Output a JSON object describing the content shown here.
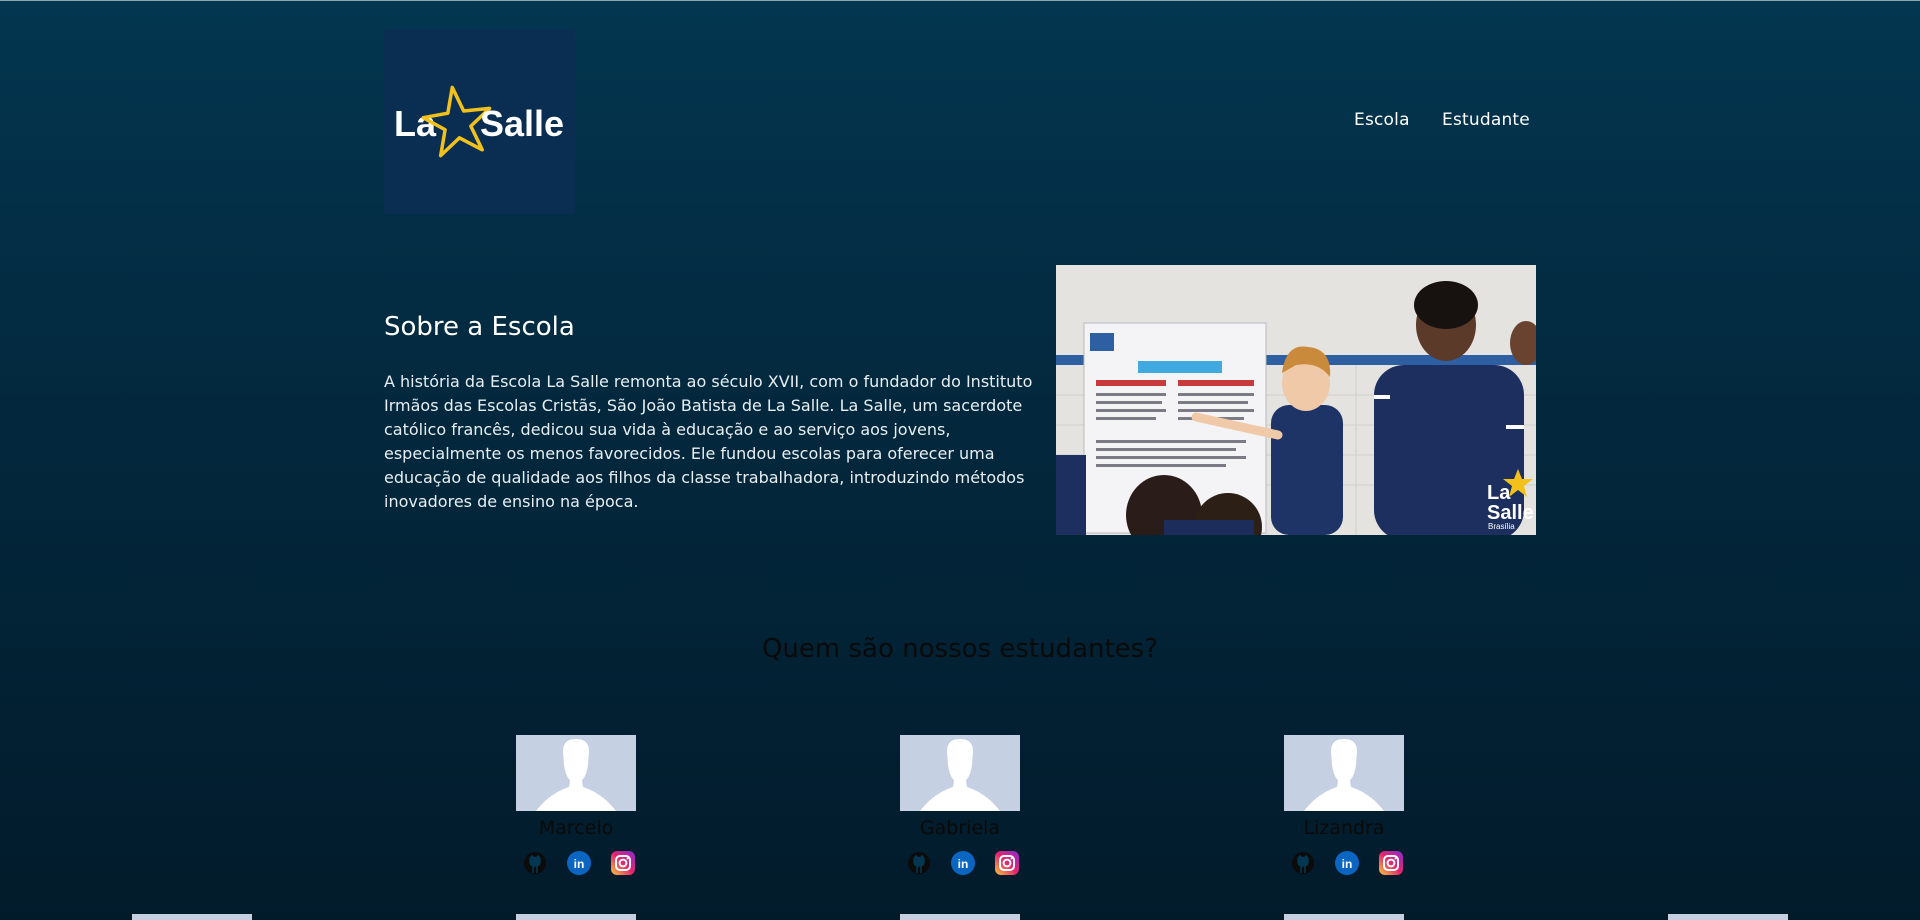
{
  "header": {
    "logo_text_left": "La",
    "logo_text_right": "Salle",
    "nav": [
      {
        "label": "Escola"
      },
      {
        "label": "Estudante"
      }
    ]
  },
  "about": {
    "title": "Sobre a Escola",
    "text": "A história da Escola La Salle remonta ao século XVII, com o fundador do Instituto Irmãos das Escolas Cristãs, São João Batista de La Salle. La Salle, um sacerdote católico francês, dedicou sua vida à educação e ao serviço aos jovens, especialmente os menos favorecidos. Ele fundou escolas para oferecer uma educação de qualidade aos filhos da classe trabalhadora, introduzindo métodos inovadores de ensino na época.",
    "photo_watermark": {
      "line1": "La",
      "line2": "Salle",
      "line3": "Brasília"
    }
  },
  "students": {
    "title": "Quem são nossos estudantes?",
    "list": [
      {
        "name": "Marcelo"
      },
      {
        "name": "Gabriela"
      },
      {
        "name": "Lizandra"
      }
    ],
    "icons": [
      "github-icon",
      "linkedin-icon",
      "instagram-icon"
    ]
  },
  "colors": {
    "background_top": "#033650",
    "background_bottom": "#021b2b",
    "logo_bg": "#0a2d52",
    "logo_star": "#f2c21b",
    "avatar_bg": "#c5d0e2",
    "linkedin": "#0a66c2"
  }
}
